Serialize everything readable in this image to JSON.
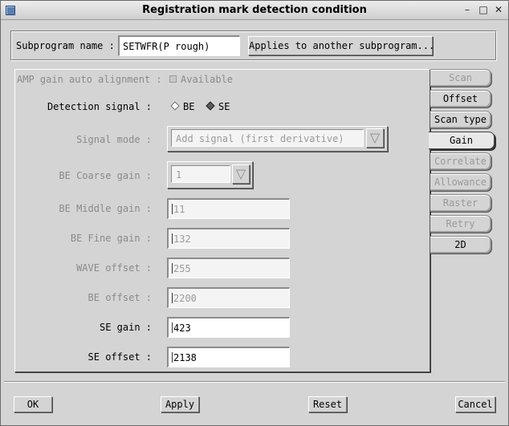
{
  "window": {
    "title": "Registration mark detection condition"
  },
  "subprogram": {
    "label": "Subprogram name :",
    "value": "SETWFR(P rough)",
    "apply_other_label": "Applies to another subprogram..."
  },
  "amp": {
    "label": "AMP gain auto alignment :",
    "checkbox_label": "Available"
  },
  "detection": {
    "label": "Detection signal :",
    "opt_be": "BE",
    "opt_se": "SE",
    "selected": "SE"
  },
  "signal_mode": {
    "label": "Signal mode :",
    "value": "Add signal (first derivative)"
  },
  "be_coarse": {
    "label": "BE Coarse gain :",
    "value": "1"
  },
  "fields": [
    {
      "label": "BE Middle gain :",
      "value": "11",
      "enabled": false
    },
    {
      "label": "BE Fine gain :",
      "value": "132",
      "enabled": false
    },
    {
      "label": "WAVE offset :",
      "value": "255",
      "enabled": false
    },
    {
      "label": "BE offset :",
      "value": "2200",
      "enabled": false
    },
    {
      "label": "SE gain :",
      "value": "423",
      "enabled": true
    },
    {
      "label": "SE offset :",
      "value": "2138",
      "enabled": true
    }
  ],
  "tabs": [
    {
      "label": "Scan",
      "state": "disabled"
    },
    {
      "label": "Offset",
      "state": "enabled"
    },
    {
      "label": "Scan type",
      "state": "enabled"
    },
    {
      "label": "Gain",
      "state": "active"
    },
    {
      "label": "Correlate",
      "state": "disabled"
    },
    {
      "label": "Allowance",
      "state": "disabled"
    },
    {
      "label": "Raster",
      "state": "disabled"
    },
    {
      "label": "Retry",
      "state": "disabled"
    },
    {
      "label": "2D",
      "state": "enabled"
    }
  ],
  "buttons": {
    "ok": "OK",
    "apply": "Apply",
    "reset": "Reset",
    "cancel": "Cancel"
  },
  "titlebar_buttons": {
    "minimize": "–",
    "maximize": "□",
    "close": "✕"
  }
}
